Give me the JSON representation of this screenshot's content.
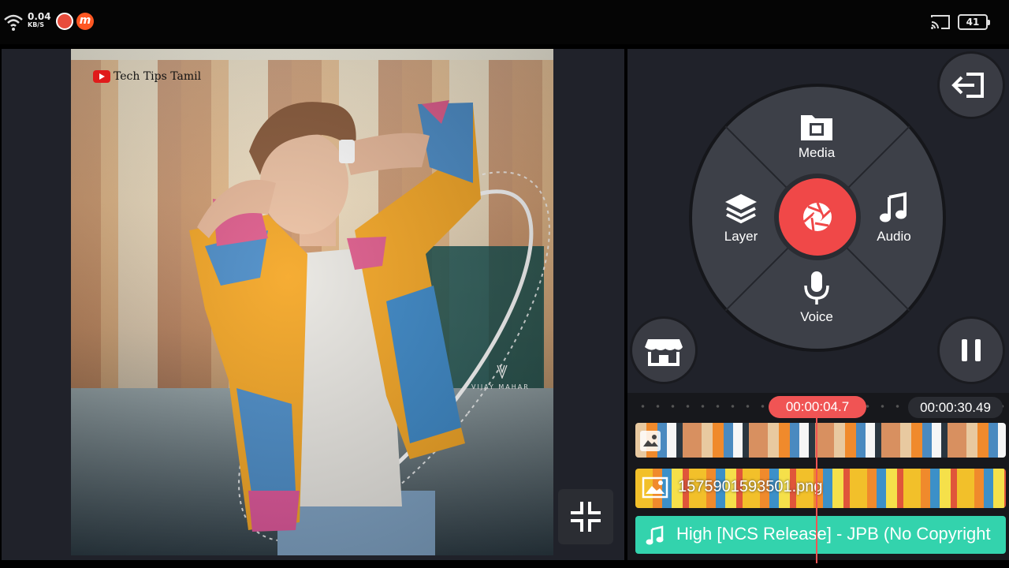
{
  "status_bar": {
    "net_speed": "0.04",
    "net_speed_unit": "KB/S",
    "battery": "41",
    "app_badge_letter": "m"
  },
  "preview": {
    "watermark": "Tech Tips Tamil",
    "signature": "VIJAY MAHAR"
  },
  "wheel": {
    "media_label": "Media",
    "layer_label": "Layer",
    "audio_label": "Audio",
    "voice_label": "Voice",
    "accent_color": "#f04848"
  },
  "timeline": {
    "current_time": "00:00:04.7",
    "total_time": "00:00:30.49",
    "image_layer_label": "1575901593501.png",
    "audio_layer_label": "High [NCS Release] - JPB  (No Copyright",
    "audio_track_color": "#33d3ad",
    "playhead_color": "#f05454"
  },
  "icons": {
    "exit": "exit-icon",
    "store": "store-icon",
    "pause": "pause-icon",
    "shrink": "shrink-icon",
    "record": "camera-shutter-icon",
    "media": "film-folder-icon",
    "layer": "layers-icon",
    "audio": "music-note-icon",
    "voice": "microphone-icon"
  }
}
